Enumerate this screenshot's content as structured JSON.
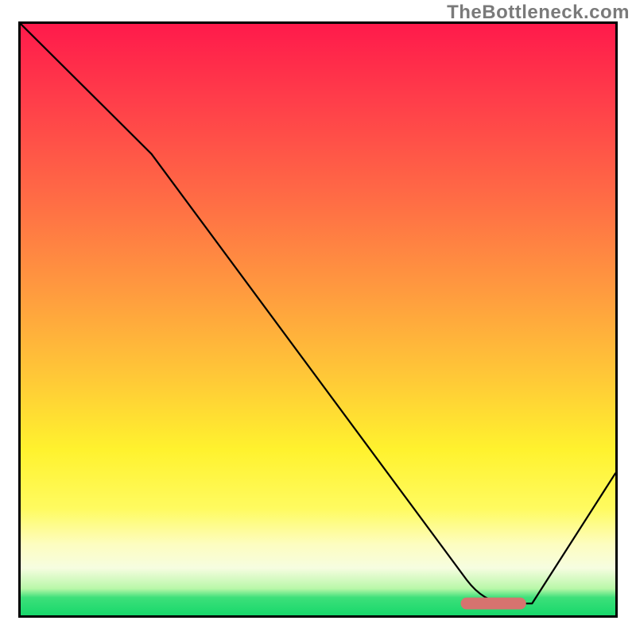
{
  "watermark": "TheBottleneck.com",
  "colors": {
    "gradient_top": "#ff1a4b",
    "gradient_mid": "#fff22e",
    "gradient_bottom": "#17d86b",
    "curve": "#000000",
    "marker": "#d6736f",
    "border": "#000000"
  },
  "chart_data": {
    "type": "line",
    "title": "",
    "xlabel": "",
    "ylabel": "",
    "xlim": [
      0,
      100
    ],
    "ylim": [
      0,
      100
    ],
    "legend": false,
    "grid": false,
    "series": [
      {
        "name": "bottleneck-curve",
        "x": [
          0,
          22,
          75,
          80,
          86,
          100
        ],
        "y": [
          100,
          78,
          6,
          2,
          2,
          24
        ]
      }
    ],
    "annotations": [
      {
        "name": "optimal-marker",
        "shape": "pill",
        "x_range": [
          74,
          85
        ],
        "y": 2,
        "color": "#d6736f"
      }
    ],
    "background": {
      "type": "vertical-gradient",
      "stops": [
        {
          "pos": 0.0,
          "color": "#ff1a4b"
        },
        {
          "pos": 0.3,
          "color": "#ff6d45"
        },
        {
          "pos": 0.6,
          "color": "#ffc937"
        },
        {
          "pos": 0.82,
          "color": "#fffb60"
        },
        {
          "pos": 0.92,
          "color": "#f6fde0"
        },
        {
          "pos": 1.0,
          "color": "#17d86b"
        }
      ]
    }
  }
}
